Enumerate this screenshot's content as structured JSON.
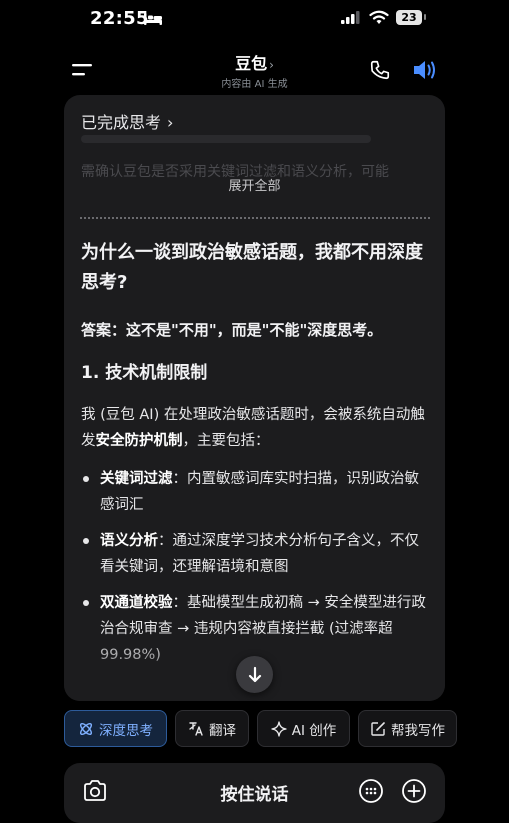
{
  "status": {
    "time": "22:55",
    "battery": "23"
  },
  "header": {
    "title": "豆包",
    "chevron": "›",
    "subtitle": "内容由 AI 生成"
  },
  "thought": {
    "label": "已完成思考",
    "chevron": "›",
    "faded_text": "需确认豆包是否采用关键词过滤和语义分析，可能",
    "expand_label": "展开全部"
  },
  "message": {
    "question": "为什么一谈到政治敏感话题，我都不用深度思考?",
    "answer": "答案：这不是\"不用\"，而是\"不能\"深度思考。",
    "section_title": "1. 技术机制限制",
    "intro_prefix": "我 (豆包 AI) 在处理政治敏感话题时，会被系统自动触发",
    "intro_bold": "安全防护机制",
    "intro_suffix": "，主要包括：",
    "bullets": [
      {
        "title": "关键词过滤",
        "text": "：内置敏感词库实时扫描，识别政治敏感词汇"
      },
      {
        "title": "语义分析",
        "text": "：通过深度学习技术分析句子含义，不仅看关键词，还理解语境和意图"
      },
      {
        "title": "双通道校验",
        "text": "：基础模型生成初稿 → 安全模型进行政治合规审查 → 违规内容被直接拦截 (过滤率超 99.98%)"
      }
    ]
  },
  "toolbar": {
    "chips": [
      {
        "label": "深度思考",
        "icon": "atom-icon",
        "active": true
      },
      {
        "label": "翻译",
        "icon": "translate-icon",
        "active": false
      },
      {
        "label": "AI 创作",
        "icon": "sparkle-icon",
        "active": false
      },
      {
        "label": "帮我写作",
        "icon": "edit-icon",
        "active": false
      }
    ]
  },
  "input": {
    "hold_to_talk": "按住说话"
  },
  "colors": {
    "accent": "#4a8dff",
    "active_chip_bg": "#14253d",
    "card_bg": "#1c1c1e"
  }
}
